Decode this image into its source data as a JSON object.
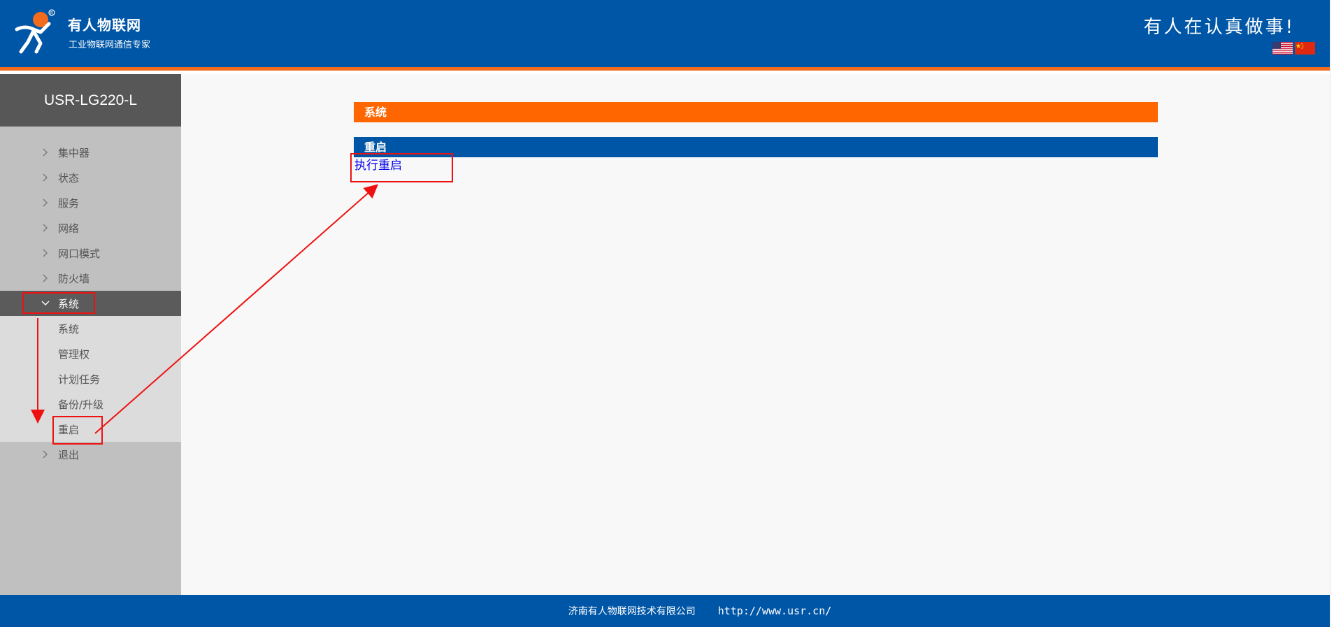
{
  "header": {
    "brand_name": "有人物联网",
    "brand_tagline": "工业物联网通信专家",
    "slogan": "有人在认真做事!",
    "colors": {
      "header_bg": "#0056a6",
      "accent": "#f36b1c"
    }
  },
  "sidebar": {
    "device_name": "USR-LG220-L",
    "items": [
      {
        "label": "集中器"
      },
      {
        "label": "状态"
      },
      {
        "label": "服务"
      },
      {
        "label": "网络"
      },
      {
        "label": "网口模式"
      },
      {
        "label": "防火墙"
      },
      {
        "label": "系统"
      }
    ],
    "system_subitems": [
      {
        "label": "系统"
      },
      {
        "label": "管理权"
      },
      {
        "label": "计划任务"
      },
      {
        "label": "备份/升级"
      },
      {
        "label": "重启"
      }
    ],
    "logout": {
      "label": "退出"
    }
  },
  "main": {
    "section_title": "系统",
    "panel_title": "重启",
    "reboot_link": "执行重启"
  },
  "footer": {
    "company": "济南有人物联网技术有限公司",
    "url": "http://www.usr.cn/"
  }
}
